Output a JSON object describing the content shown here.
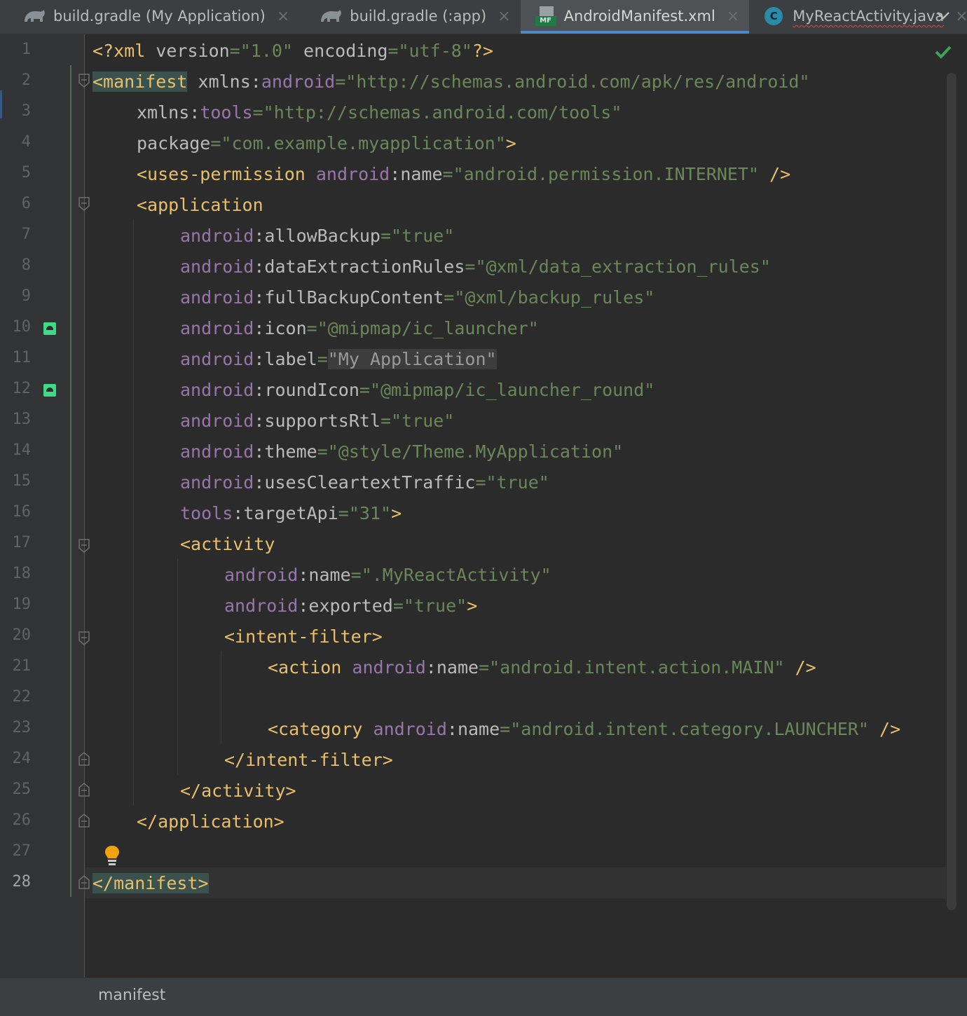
{
  "tabs": [
    {
      "label": "build.gradle (My Application)",
      "icon": "gradle-elephant-icon",
      "active": false
    },
    {
      "label": "build.gradle (:app)",
      "icon": "gradle-elephant-icon",
      "active": false
    },
    {
      "label": "AndroidManifest.xml",
      "icon": "manifest-file-icon",
      "active": true
    },
    {
      "label": "MyReactActivity.java",
      "icon": "java-class-icon",
      "active": false
    }
  ],
  "manifest_icon_label": "MF",
  "class_icon_letter": "C",
  "line_numbers": [
    "1",
    "2",
    "3",
    "4",
    "5",
    "6",
    "7",
    "8",
    "9",
    "10",
    "11",
    "12",
    "13",
    "14",
    "15",
    "16",
    "17",
    "18",
    "19",
    "20",
    "21",
    "22",
    "23",
    "24",
    "25",
    "26",
    "27",
    "28"
  ],
  "current_line": 28,
  "code": {
    "l1": {
      "a": "<?xml ",
      "b": "version",
      "c": "=\"1.0\" ",
      "d": "encoding",
      "e": "=\"utf-8\"",
      "f": "?>"
    },
    "l2": {
      "tag": "<manifest",
      "sp": " ",
      "attr": "xmlns",
      "colon": ":",
      "ns": "android",
      "val": "=\"http://schemas.android.com/apk/res/android\""
    },
    "l3": {
      "attr": "xmlns",
      "colon": ":",
      "ns": "tools",
      "val": "=\"http://schemas.android.com/tools\""
    },
    "l4": {
      "attr": "package",
      "val": "=\"com.example.myapplication\"",
      "end": ">"
    },
    "l5": {
      "tag": "<uses-permission",
      "ns": " android",
      "colon": ":",
      "attr": "name",
      "val": "=\"android.permission.INTERNET\"",
      "end": " />"
    },
    "l6": {
      "tag": "<application"
    },
    "l7": {
      "ns": "android",
      "colon": ":",
      "attr": "allowBackup",
      "val": "=\"true\""
    },
    "l8": {
      "ns": "android",
      "colon": ":",
      "attr": "dataExtractionRules",
      "val": "=\"@xml/data_extraction_rules\""
    },
    "l9": {
      "ns": "android",
      "colon": ":",
      "attr": "fullBackupContent",
      "val": "=\"@xml/backup_rules\""
    },
    "l10": {
      "ns": "android",
      "colon": ":",
      "attr": "icon",
      "val": "=\"@mipmap/ic_launcher\""
    },
    "l11": {
      "ns": "android",
      "colon": ":",
      "attr": "label",
      "eq": "=",
      "val": "\"My Application\""
    },
    "l12": {
      "ns": "android",
      "colon": ":",
      "attr": "roundIcon",
      "val": "=\"@mipmap/ic_launcher_round\""
    },
    "l13": {
      "ns": "android",
      "colon": ":",
      "attr": "supportsRtl",
      "val": "=\"true\""
    },
    "l14": {
      "ns": "android",
      "colon": ":",
      "attr": "theme",
      "val": "=\"@style/Theme.MyApplication\""
    },
    "l15": {
      "ns": "android",
      "colon": ":",
      "attr": "usesCleartextTraffic",
      "val": "=\"true\""
    },
    "l16": {
      "ns": "tools",
      "colon": ":",
      "attr": "targetApi",
      "val": "=\"31\"",
      "end": ">"
    },
    "l17": {
      "tag": "<activity"
    },
    "l18": {
      "ns": "android",
      "colon": ":",
      "attr": "name",
      "val": "=\".MyReactActivity\""
    },
    "l19": {
      "ns": "android",
      "colon": ":",
      "attr": "exported",
      "val": "=\"true\"",
      "end": ">"
    },
    "l20": {
      "tag": "<intent-filter>"
    },
    "l21": {
      "tag": "<action",
      "ns": " android",
      "colon": ":",
      "attr": "name",
      "val": "=\"android.intent.action.MAIN\"",
      "end": " />"
    },
    "l23": {
      "tag": "<category",
      "ns": " android",
      "colon": ":",
      "attr": "name",
      "val": "=\"android.intent.category.LAUNCHER\"",
      "end": " />"
    },
    "l24": {
      "tag": "</intent-filter>"
    },
    "l25": {
      "tag": "</activity>"
    },
    "l26": {
      "tag": "</application>"
    },
    "l28": {
      "tag": "</manifest>"
    }
  },
  "breadcrumb": "manifest",
  "inspection_status_icon": "check-icon",
  "colors": {
    "tag": "#e8bf6a",
    "attribute": "#bababa",
    "namespace": "#9876aa",
    "string": "#6a8759",
    "active_tab_underline": "#4a88c7",
    "check": "#3fa356"
  }
}
